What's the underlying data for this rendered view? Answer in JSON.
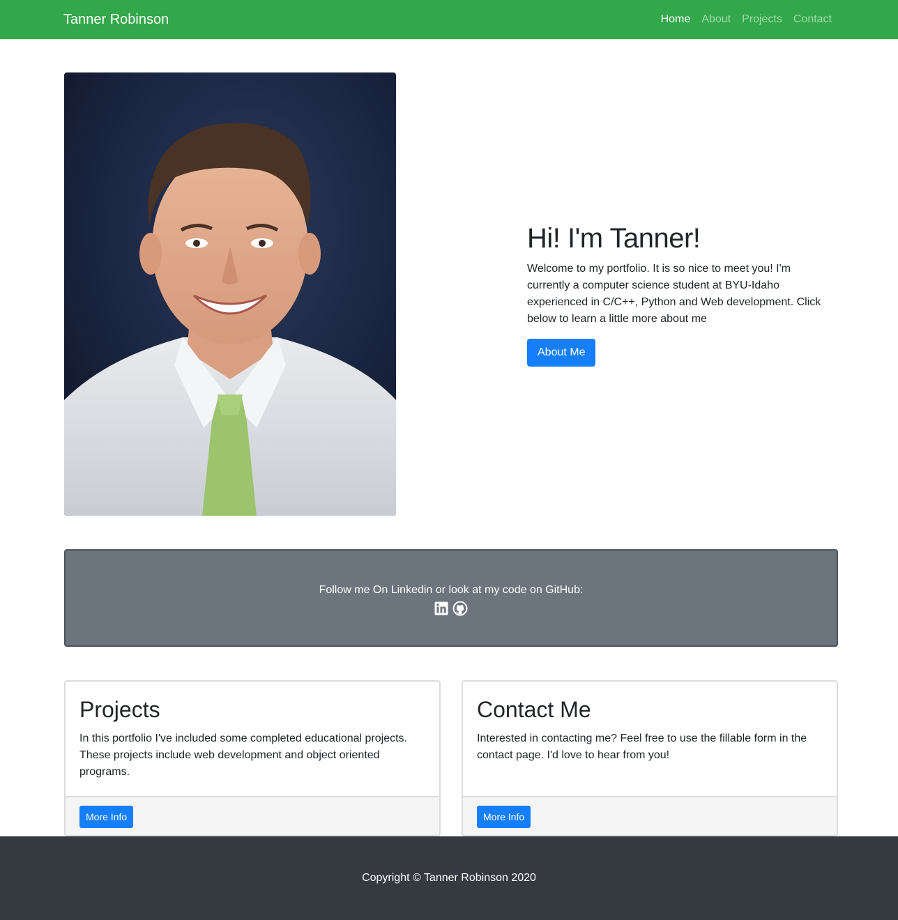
{
  "navbar": {
    "brand": "Tanner Robinson",
    "links": [
      "Home",
      "About",
      "Projects",
      "Contact"
    ],
    "active": "Home",
    "background": "#32a84a"
  },
  "hero": {
    "photo_alt": "Portrait photo of Tanner Robinson",
    "heading": "Hi! I'm Tanner!",
    "intro": "Welcome to my portfolio. It is so nice to meet you! I'm currently a computer science student at BYU-Idaho experienced in C/C++, Python and Web development. Click below to learn a little more about me",
    "button": "About Me"
  },
  "social": {
    "text": "Follow me On Linkedin or look at my code on GitHub:",
    "icons": [
      "linkedin-icon",
      "github-icon"
    ],
    "background": "#6c757d"
  },
  "cards": [
    {
      "title": "Projects",
      "text": "In this portfolio I've included some completed educational projects. These projects include web development and object oriented programs.",
      "button": "More Info"
    },
    {
      "title": "Contact Me",
      "text": "Interested in contacting me? Feel free to use the fillable form in the contact page. I'd love to hear from you!",
      "button": "More Info"
    }
  ],
  "footer": {
    "text": "Copyright © Tanner Robinson 2020",
    "background": "#343a40"
  },
  "colors": {
    "primary": "#157efb"
  }
}
